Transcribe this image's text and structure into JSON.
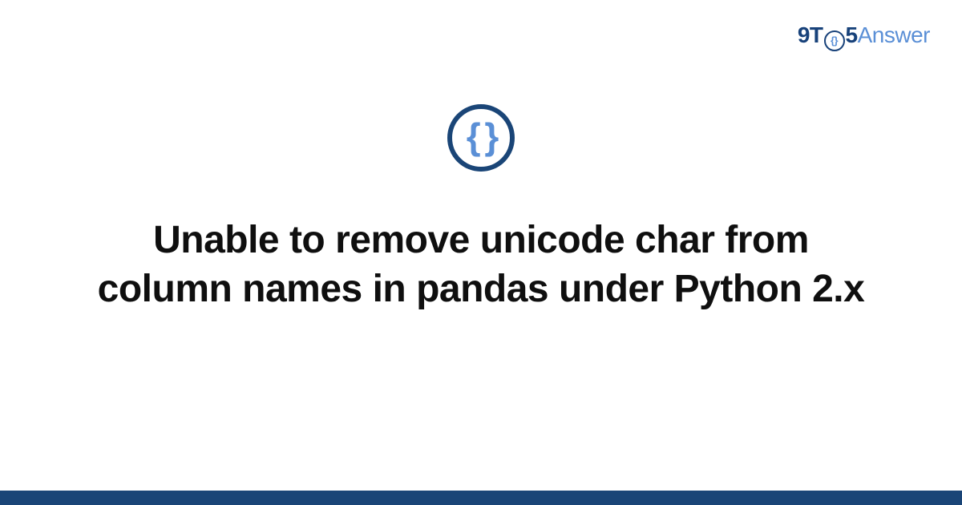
{
  "logo": {
    "part1": "9T",
    "inner": "{}",
    "part2": "5",
    "part3": "Answer"
  },
  "category_icon": {
    "symbol": "{ }",
    "name": "code-braces"
  },
  "title": "Unable to remove unicode char from column names in pandas under Python 2.x",
  "colors": {
    "brand_dark": "#1a4577",
    "brand_light": "#5a8fd6"
  }
}
